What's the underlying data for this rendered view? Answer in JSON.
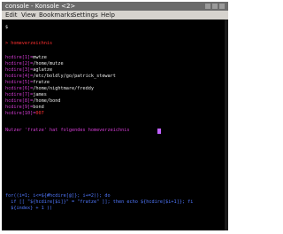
{
  "window": {
    "title": "console - Konsole <2>"
  },
  "menu": [
    "Edit",
    "View",
    "Bookmarks",
    "Settings",
    "Help"
  ],
  "terminal": {
    "prompt": "$",
    "command_line": "> homeverzeichnis",
    "entries": [
      {
        "prefix": "hcdire[1]=",
        "value": "mwtze"
      },
      {
        "prefix": "hcdire[2]=",
        "value": "/home/mutze"
      },
      {
        "prefix": "hcdire[3]=",
        "value": "aglatze"
      },
      {
        "prefix": "hcdire[4]=",
        "value": "/etc/boldly/go/patrick_stewart"
      },
      {
        "prefix": "hcdire[5]=",
        "value": "fratze"
      },
      {
        "prefix": "hcdire[6]=",
        "value": "/home/nightmare/freddy"
      },
      {
        "prefix": "hcdire[7]=",
        "value": "james"
      },
      {
        "prefix": "hcdire[8]=",
        "value": "/home/bond"
      },
      {
        "prefix": "hcdire[9]=",
        "value": "bond"
      },
      {
        "prefix": "hcdire[10]=",
        "value": "007"
      }
    ],
    "result_line": "Nutzer 'fratze' hat folgendes homeverzeichnis",
    "code_lines": [
      "for((i=1; i<=${#hcdire[@]}; i+=2)); do",
      "  if [[ \"${hcdire[$i]}\" = \"fratze\" ]]; then echo ${hcdire[$i+1]}; fi",
      "  ${index} + 1 ))"
    ]
  },
  "colors": {
    "background": "#000000",
    "text": "#e8e8e8",
    "magenta": "#d23bd2",
    "red": "#ff3030",
    "blue": "#5078ff"
  }
}
